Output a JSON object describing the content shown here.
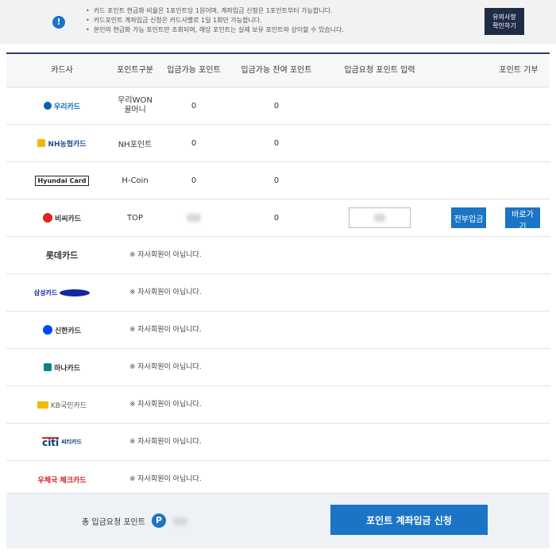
{
  "notice": {
    "lines": [
      "카드 포인트 현금화 비율은 1포인트당 1원이며, 계좌입금 신청은 1포인트부터 가능합니다.",
      "카드포인트 계좌입금 신청은 카드사별로 1일 1회만 가능합니다.",
      "본인의 현금화 가능 포인트만 조회되며, 해당 포인트는 실제 보유 포인트와 상이할 수 있습니다."
    ],
    "caution_button": "유의사항\n확인하기"
  },
  "headers": {
    "card": "카드사",
    "point_type": "포인트구분",
    "available": "입금가능 포인트",
    "remainder": "입금가능 잔여 포인트",
    "request_input": "입금요청 포인트 입력",
    "donate": "포인트 기부"
  },
  "rows": [
    {
      "card": "우리카드",
      "type": "우리WON\n꿀머니",
      "available": "0",
      "remainder": "0",
      "color": "#0a62b3"
    },
    {
      "card": "NH농협카드",
      "type": "NH포인트",
      "available": "0",
      "remainder": "0",
      "color": "#1d4f91"
    },
    {
      "card": "Hyundai Card",
      "type": "H-Coin",
      "available": "0",
      "remainder": "0",
      "color": "#222222"
    },
    {
      "card": "비씨카드",
      "type": "TOP",
      "available": "",
      "remainder": "0",
      "color": "#e2231a"
    },
    {
      "card": "롯데카드",
      "not_member": "※ 자사회원이 아닙니다.",
      "color": "#333333"
    },
    {
      "card": "삼성카드",
      "not_member": "※ 자사회원이 아닙니다.",
      "color": "#1428a0"
    },
    {
      "card": "신한카드",
      "not_member": "※ 자사회원이 아닙니다.",
      "color": "#0046ff"
    },
    {
      "card": "하나카드",
      "not_member": "※ 자사회원이 아닙니다.",
      "color": "#008485"
    },
    {
      "card": "KB국민카드",
      "not_member": "※ 자사회원이 아닙니다.",
      "color": "#60584c"
    },
    {
      "card": "씨티카드",
      "not_member": "※ 자사회원이 아닙니다.",
      "color": "#003b70"
    },
    {
      "card": "우체국 체크카드",
      "not_member": "※ 자사회원이 아닙니다.",
      "color": "#d71920"
    }
  ],
  "bc_actions": {
    "all_deposit": "전부입금",
    "go": "바로가기"
  },
  "footer": {
    "total_label": "총 입금요청 포인트",
    "p_badge": "P",
    "apply_button": "포인트 계좌입금 신청"
  },
  "colors": {
    "accent": "#1b74c5",
    "header_border": "#2b3f66",
    "caution_button": "#1f2c45"
  }
}
